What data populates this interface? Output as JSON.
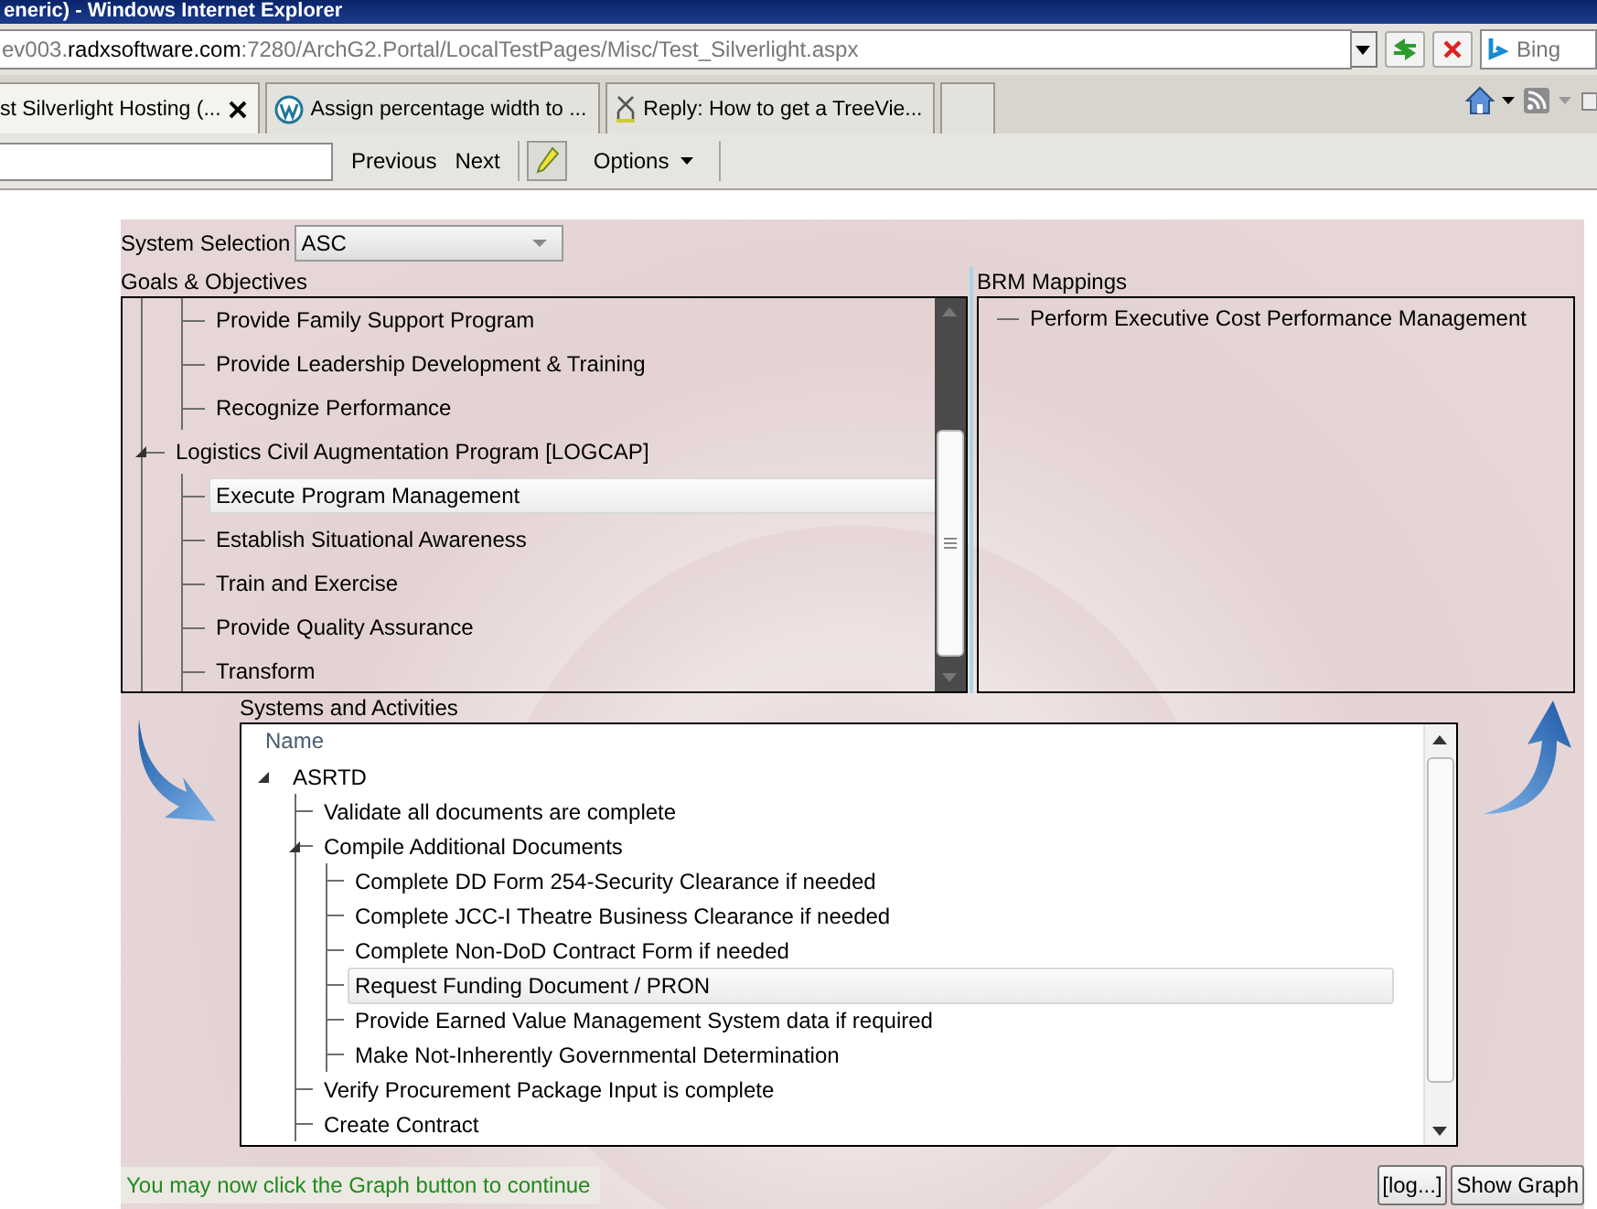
{
  "window": {
    "title": "eneric) - Windows Internet Explorer"
  },
  "address_bar": {
    "url_start": "ev003.",
    "url_domain": "radxsoftware.com",
    "url_rest": ":7280/ArchG2.Portal/LocalTestPages/Misc/Test_Silverlight.aspx"
  },
  "search_box": {
    "placeholder": "Bing"
  },
  "tabs": [
    {
      "label": "st Silverlight Hosting (...",
      "selected": true,
      "kind": "plain"
    },
    {
      "label": "Assign percentage width to ...",
      "selected": false,
      "kind": "circle-logo"
    },
    {
      "label": "Reply: How to get a TreeVie...",
      "selected": false,
      "kind": "ribbon"
    },
    {
      "selected": false,
      "kind": "new"
    }
  ],
  "find_bar": {
    "buttons": [
      "Previous",
      "Next"
    ],
    "options": "Options"
  },
  "system_selection": {
    "label": "System Selection",
    "value": "ASC"
  },
  "goals": {
    "title": "Goals & Objectives",
    "continued_children": [
      {
        "label": "Provide Family Support Program",
        "selected": false
      },
      {
        "label": "Provide Leadership Development & Training",
        "selected": false
      },
      {
        "label": "Recognize Performance",
        "selected": false
      }
    ],
    "items": [
      {
        "label": "Logistics Civil Augmentation Program [LOGCAP]",
        "selected": false,
        "expanded": true,
        "children": [
          {
            "label": "Execute Program Management",
            "selected": true
          },
          {
            "label": "Establish Situational Awareness",
            "selected": false
          },
          {
            "label": "Train and Exercise",
            "selected": false
          },
          {
            "label": "Provide Quality Assurance",
            "selected": false
          },
          {
            "label": "Transform",
            "selected": false
          }
        ]
      }
    ]
  },
  "brm": {
    "title": "BRM Mappings",
    "items": [
      {
        "label": "Perform Executive Cost Performance Management",
        "selected": false
      }
    ]
  },
  "systems": {
    "title": "Systems and Activities",
    "column_header": "Name",
    "items": [
      {
        "label": "ASRTD",
        "selected": false,
        "expanded": true,
        "children": [
          {
            "label": "Validate all documents are complete",
            "selected": false
          },
          {
            "label": "Compile Additional Documents",
            "selected": false,
            "expanded": true,
            "children": [
              {
                "label": "Complete DD Form 254-Security Clearance if needed",
                "selected": false
              },
              {
                "label": "Complete JCC-I Theatre Business Clearance if needed",
                "selected": false
              },
              {
                "label": "Complete Non-DoD Contract Form if needed",
                "selected": false
              },
              {
                "label": "Request Funding Document / PRON",
                "selected": true
              },
              {
                "label": "Provide Earned Value Management System data if required",
                "selected": false
              },
              {
                "label": "Make Not-Inherently Governmental Determination",
                "selected": false
              }
            ]
          },
          {
            "label": "Verify Procurement Package Input is complete",
            "selected": false
          },
          {
            "label": "Create Contract",
            "selected": false
          }
        ]
      }
    ]
  },
  "status_message": "You may now click the Graph button to continue",
  "buttons": [
    "[log...]",
    "Show Graph"
  ]
}
